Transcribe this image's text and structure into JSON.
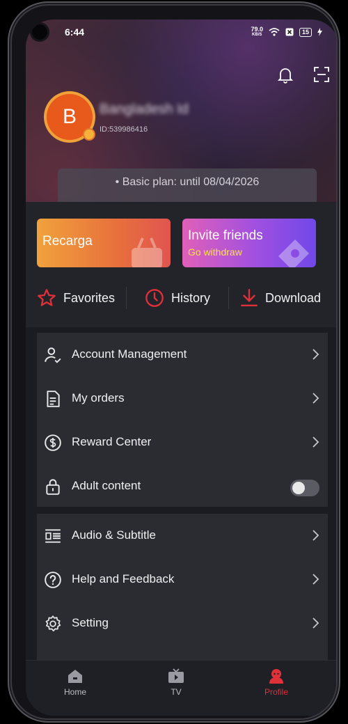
{
  "status": {
    "time": "6:44",
    "speed_value": "79.0",
    "speed_unit": "KB/S",
    "battery": "15"
  },
  "profile": {
    "avatar_letter": "B",
    "username": "Bangladesh Id",
    "id_text": "ID:539986416",
    "plan_text": "• Basic plan: until 08/04/2026"
  },
  "promos": {
    "recarga": {
      "title": "Recarga"
    },
    "invite": {
      "title": "Invite friends",
      "subtitle": "Go withdraw"
    }
  },
  "quick": {
    "favorites": "Favorites",
    "history": "History",
    "download": "Download"
  },
  "menu1": {
    "account": "Account Management",
    "orders": "My orders",
    "reward": "Reward Center",
    "adult": "Adult content"
  },
  "menu2": {
    "audio": "Audio & Subtitle",
    "help": "Help and Feedback",
    "setting": "Setting"
  },
  "nav": {
    "home": "Home",
    "tv": "TV",
    "profile": "Profile"
  },
  "colors": {
    "accent": "#e0303a",
    "avatar": "#e85a1c",
    "background": "#1b1b22"
  }
}
